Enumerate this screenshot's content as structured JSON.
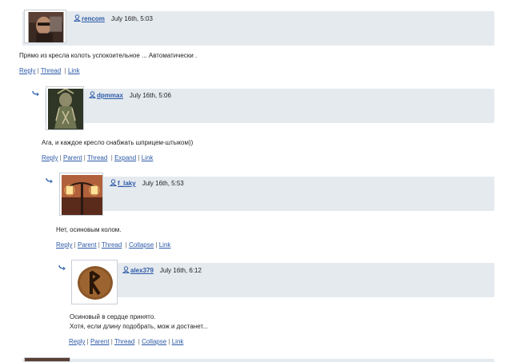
{
  "comments": [
    {
      "username": "rencom",
      "date": "July 16th, 5:03",
      "text": [
        "Прямо из кресла колоть успокоительное ... Автоматически ."
      ],
      "links": [
        "Reply",
        "Thread",
        "Link"
      ],
      "avatar": "man-portrait"
    },
    {
      "username": "dpmmax",
      "date": "July 16th, 5:06",
      "text": [
        "Ага, и каждое кресло снабжать шприцем-штыком))"
      ],
      "links": [
        "Reply",
        "Parent",
        "Thread",
        "Expand",
        "Link"
      ],
      "avatar": "shaman-figure"
    },
    {
      "username": "f_laky",
      "date": "July 16th, 5:53",
      "text": [
        "Нет, осиновым колом."
      ],
      "links": [
        "Reply",
        "Parent",
        "Thread",
        "Collapse",
        "Link"
      ],
      "avatar": "street-lamp"
    },
    {
      "username": "alex379",
      "date": "July 16th, 6:12",
      "text": [
        "Осиновый в сердце принято.",
        "Хотя, если длину подобрать, мож и достанет..."
      ],
      "links": [
        "Reply",
        "Parent",
        "Thread",
        "Collapse",
        "Link"
      ],
      "avatar": "rune-stone"
    }
  ],
  "colors": {
    "link": "#2d5aa8",
    "header_bg": "#e5eaef",
    "arrow": "#4a76b8"
  }
}
